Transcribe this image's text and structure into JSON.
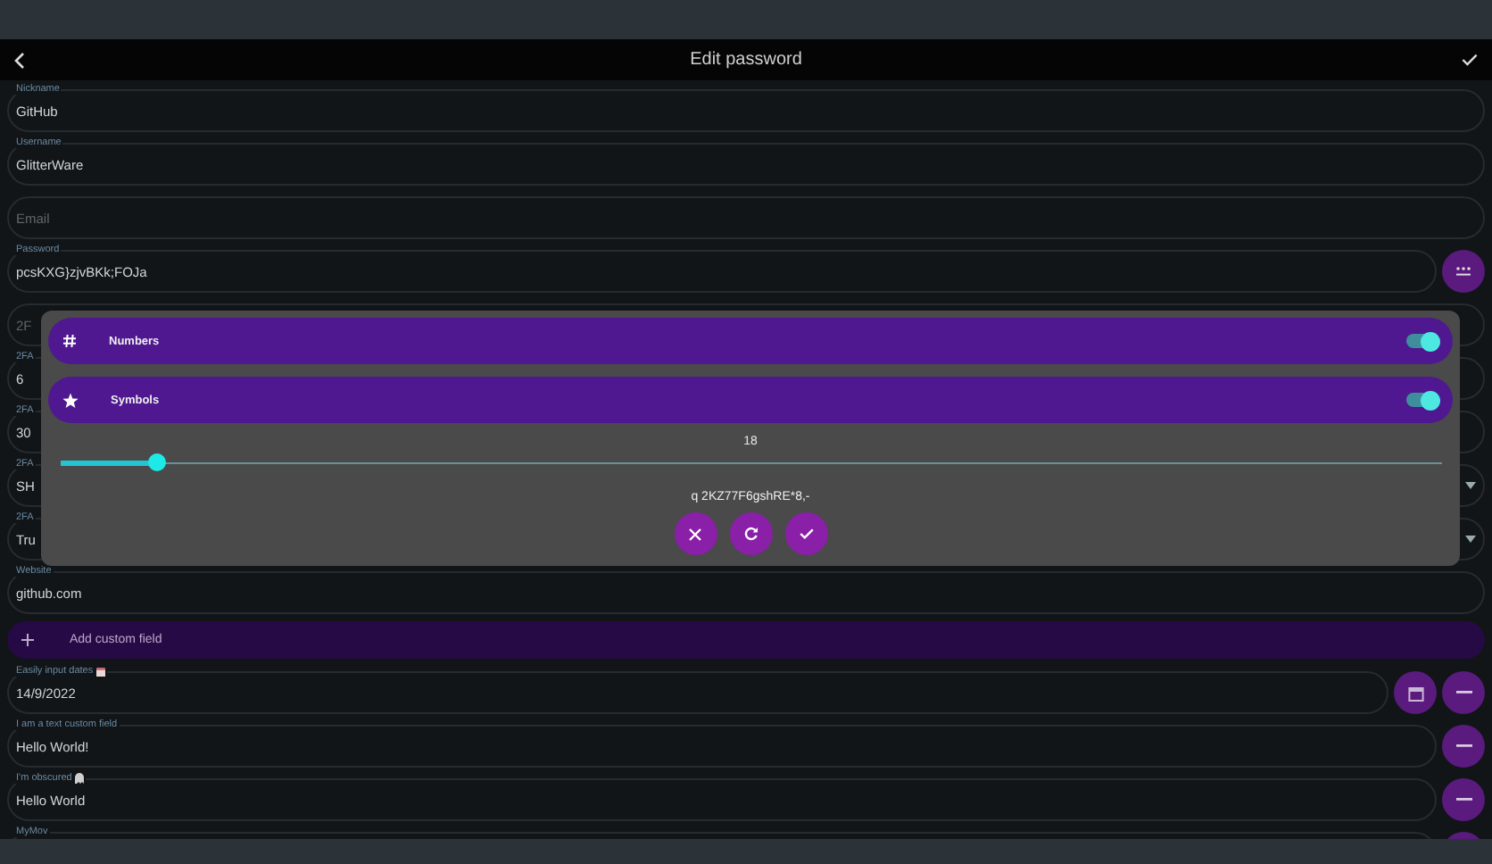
{
  "app_bar": {
    "title": "Edit password"
  },
  "fields": [
    {
      "kind": "plain",
      "label": "Nickname",
      "value": "GitHub"
    },
    {
      "kind": "plain",
      "label": "Username",
      "value": "GlitterWare"
    },
    {
      "kind": "plain",
      "placeholder": "Email"
    },
    {
      "kind": "password",
      "label": "Password",
      "value": "pcsKXG}zjvBKk;FOJa"
    },
    {
      "kind": "plain",
      "placeholder": "2F"
    },
    {
      "kind": "plain",
      "label": "2FA",
      "value": "6"
    },
    {
      "kind": "plain",
      "label": "2FA",
      "value": "30"
    },
    {
      "kind": "select",
      "label": "2FA",
      "value": "SH"
    },
    {
      "kind": "select",
      "label": "2FA",
      "value": "Tru"
    },
    {
      "kind": "plain",
      "label": "Website",
      "value": "github.com"
    }
  ],
  "add_custom_field": {
    "label": "Add custom field"
  },
  "custom_fields": [
    {
      "kind": "date",
      "label": "Easily input dates",
      "value": "14/9/2022"
    },
    {
      "kind": "text",
      "label": "I am a text custom field",
      "value": "Hello World!"
    },
    {
      "kind": "obscured",
      "label": "I'm obscured",
      "value": "Hello World"
    },
    {
      "kind": "text",
      "label": "MyMov"
    }
  ],
  "generator": {
    "options": [
      {
        "kind": "numbers",
        "label": "Numbers",
        "on": true
      },
      {
        "kind": "symbols",
        "label": "Symbols",
        "on": true
      }
    ],
    "length": "18",
    "level": 0.07,
    "preview": "q 2KZ77F6gshRE*8,-"
  }
}
